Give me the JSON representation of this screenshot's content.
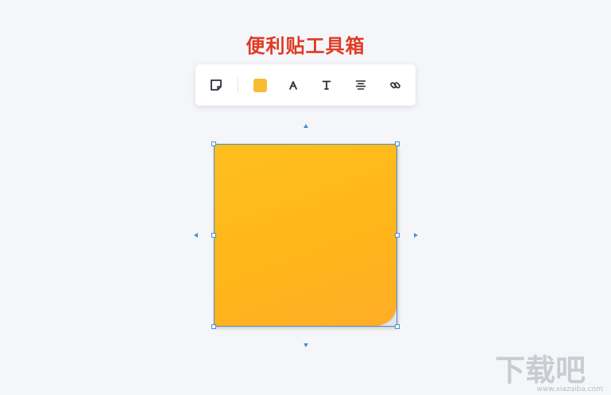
{
  "page": {
    "title": "便利贴工具箱",
    "title_color": "#e03a22",
    "background": "#f5f6fa"
  },
  "toolbar": {
    "tools": [
      {
        "name": "shape-tool",
        "icon": "sticky-shape-icon"
      },
      {
        "name": "color-tool",
        "icon": "color-swatch-icon",
        "color": "#f8bc34"
      },
      {
        "name": "font-tool",
        "icon": "font-a-icon"
      },
      {
        "name": "text-tool",
        "icon": "text-t-icon"
      },
      {
        "name": "align-tool",
        "icon": "align-center-icon"
      },
      {
        "name": "link-tool",
        "icon": "link-icon"
      }
    ]
  },
  "sticky_note": {
    "color": "#ffb619",
    "color_light": "#ffbf1f",
    "color_dark": "#ffad28",
    "selection_color": "#4a8fd4"
  },
  "watermark": {
    "text": "下载吧",
    "url": "www.xiazaiba.com",
    "color": "#c9ccd1"
  }
}
